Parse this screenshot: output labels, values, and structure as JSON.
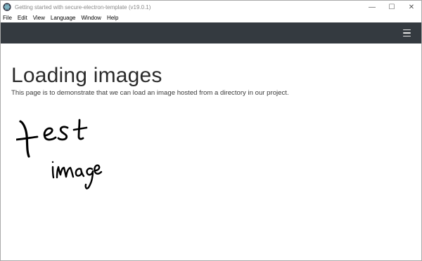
{
  "window": {
    "title": "Getting started with secure-electron-template (v19.0.1)",
    "controls": {
      "minimize": "—",
      "maximize": "☐",
      "close": "✕"
    }
  },
  "menu": {
    "items": [
      "File",
      "Edit",
      "View",
      "Language",
      "Window",
      "Help"
    ]
  },
  "navbar": {
    "menu_toggle_icon": "hamburger-menu-icon",
    "background": "#343a40"
  },
  "main": {
    "title": "Loading images",
    "description": "This page is to demonstrate that we can load an image hosted from a directory in our project.",
    "image_text": "test image"
  }
}
